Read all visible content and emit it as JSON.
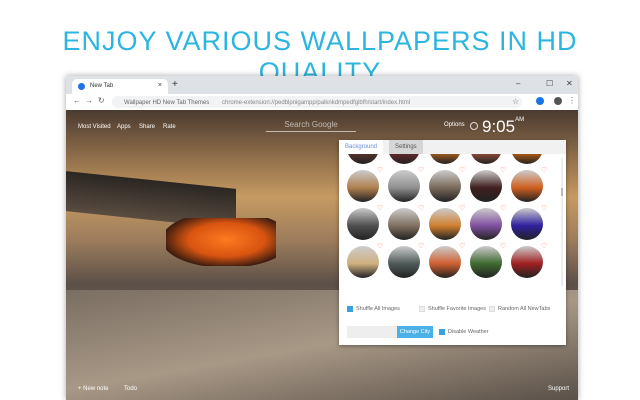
{
  "headline": "ENJOY VARIOUS WALLPAPERS IN HD QUALITY",
  "browser": {
    "tab_title": "New Tab",
    "new_tab": "+",
    "minimize": "–",
    "maximize": "☐",
    "close": "✕",
    "tab_close": "×",
    "page_name": "Wallpaper HD New Tab Themes",
    "url": "chrome-extension://pedblpnigampp/palknkdmpedfgibfh/start/index.html"
  },
  "nav": [
    "Most Visited",
    "Apps",
    "Share",
    "Rate"
  ],
  "search_placeholder": "Search Google",
  "options": "Options",
  "clock": {
    "time": "9:05",
    "ampm": "AM"
  },
  "panel": {
    "tabs": [
      "Background",
      "Settings"
    ],
    "thumb_colors": [
      [
        "#6a3a30",
        "#7a2a30",
        "#d07020",
        "#b05a40",
        "#e07010"
      ],
      [
        "#b08050",
        "#909090",
        "#7a6a5a",
        "#402020",
        "#d06020"
      ],
      [
        "#505050",
        "#807060",
        "#d08030",
        "#8050a0",
        "#3020a0"
      ],
      [
        "#d0b080",
        "#505a5a",
        "#d06030",
        "#406a30",
        "#a02020"
      ]
    ],
    "options": [
      {
        "label": "Shuffle All Images",
        "checked": true
      },
      {
        "label": "Shuffle Favorite Images",
        "checked": false
      },
      {
        "label": "Random All NewTabs",
        "checked": false
      }
    ],
    "change_city": "Change City",
    "disable_weather": {
      "label": "Disable Weather",
      "checked": true
    }
  },
  "bottom": {
    "new_note": "+ New note",
    "todo": "Todo",
    "support": "Support"
  },
  "colors": {
    "accent": "#2bb5e0",
    "button": "#4ab0e8"
  }
}
